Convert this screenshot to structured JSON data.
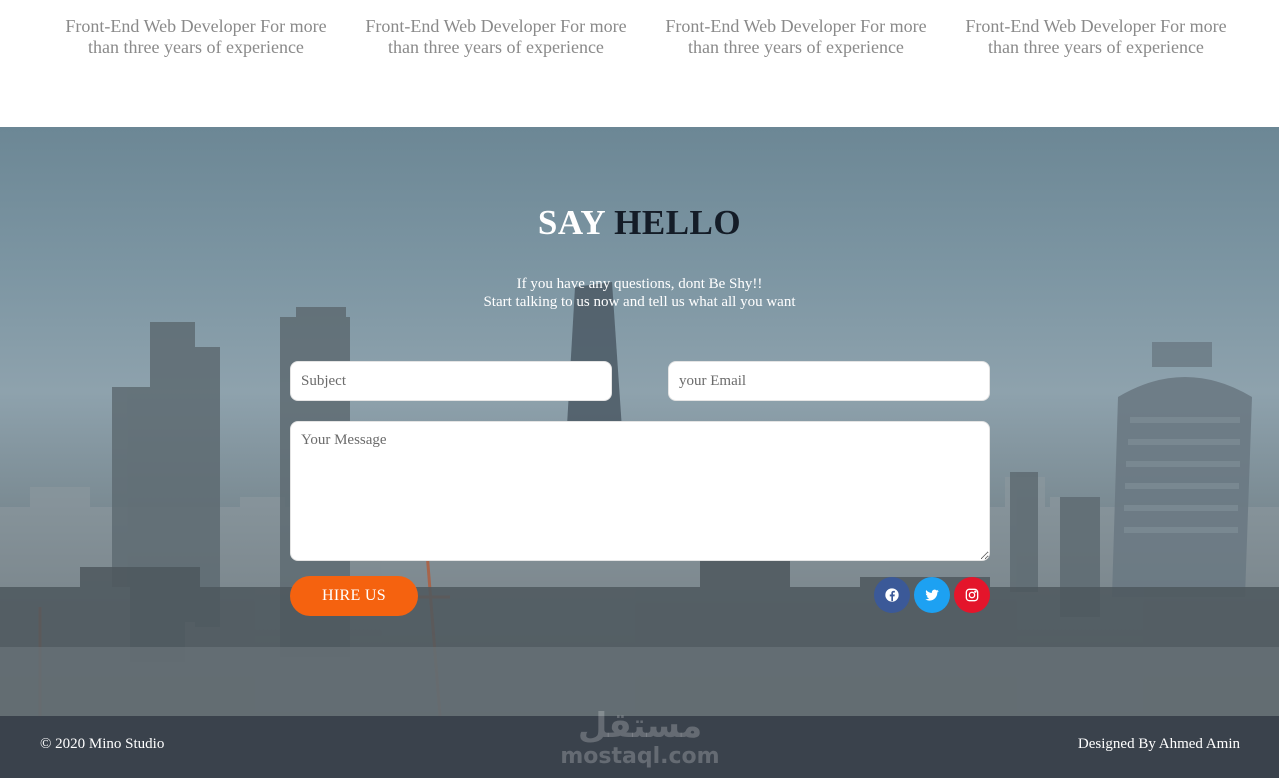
{
  "team": {
    "cards": [
      {
        "line1": "Front-End Web Developer For more",
        "line2": "than three years of experience"
      },
      {
        "line1": "Front-End Web Developer For more",
        "line2": "than three years of experience"
      },
      {
        "line1": "Front-End Web Developer For more",
        "line2": "than three years of experience"
      },
      {
        "line1": "Front-End Web Developer For more",
        "line2": "than three years of experience"
      }
    ]
  },
  "contact": {
    "title_part1": "SAY",
    "title_part2": "HELLO",
    "intro_line1": "If you have any questions, dont Be Shy!!",
    "intro_line2": "Start talking to us now and tell us what all you want",
    "subject_placeholder": "Subject",
    "email_placeholder": "your Email",
    "message_placeholder": "Your Message",
    "hire_label": "HIRE US",
    "social": [
      {
        "name": "facebook-icon",
        "color": "#3b5998"
      },
      {
        "name": "twitter-icon",
        "color": "#1da1f2"
      },
      {
        "name": "instagram-icon",
        "color": "#e4152b"
      }
    ]
  },
  "footer": {
    "copyright": "© 2020 Mino Studio",
    "credit": "Designed By Ahmed Amin",
    "watermark_arabic": "مستقل",
    "watermark_latin": "mostaql.com"
  },
  "colors": {
    "accent": "#f5620f",
    "footer_bg": "#3a424c",
    "title_dark": "#141c27"
  }
}
